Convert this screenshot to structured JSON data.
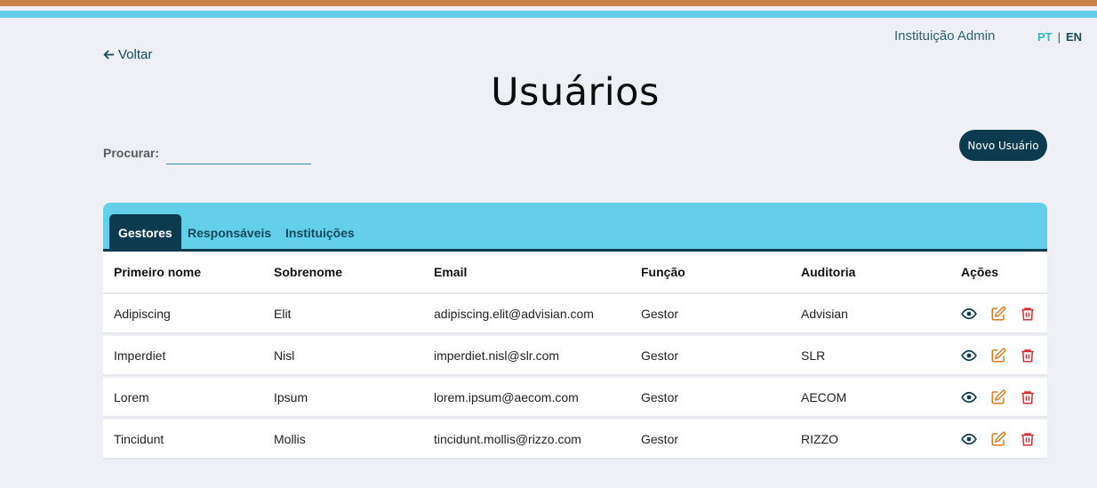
{
  "colors": {
    "brand_dark": "#0c3b4f",
    "accent_blue": "#63cfe9",
    "accent_orange": "#c98349",
    "edit_orange": "#e0781d",
    "delete_red": "#d62f2f"
  },
  "header": {
    "institution_admin": "Instituição Admin",
    "lang_pt": "PT",
    "lang_sep": "|",
    "lang_en": "EN"
  },
  "nav": {
    "back_label": "Voltar"
  },
  "page": {
    "title": "Usuários"
  },
  "search": {
    "label": "Procurar:",
    "value": "",
    "placeholder": ""
  },
  "actions": {
    "new_user_label": "Novo Usuário"
  },
  "tabs": [
    {
      "label": "Gestores",
      "active": true
    },
    {
      "label": "Responsáveis",
      "active": false
    },
    {
      "label": "Instituições",
      "active": false
    }
  ],
  "table": {
    "columns": [
      "Primeiro nome",
      "Sobrenome",
      "Email",
      "Função",
      "Auditoria",
      "Ações"
    ],
    "rows": [
      {
        "first": "Adipiscing",
        "last": "Elit",
        "email": "adipiscing.elit@advisian.com",
        "role": "Gestor",
        "audit": "Advisian"
      },
      {
        "first": "Imperdiet",
        "last": "Nisl",
        "email": "imperdiet.nisl@slr.com",
        "role": "Gestor",
        "audit": "SLR"
      },
      {
        "first": "Lorem",
        "last": "Ipsum",
        "email": "lorem.ipsum@aecom.com",
        "role": "Gestor",
        "audit": "AECOM"
      },
      {
        "first": "Tincidunt",
        "last": "Mollis",
        "email": "tincidunt.mollis@rizzo.com",
        "role": "Gestor",
        "audit": "RIZZO"
      }
    ],
    "row_icons": [
      "eye-icon",
      "edit-icon",
      "trash-icon"
    ]
  }
}
